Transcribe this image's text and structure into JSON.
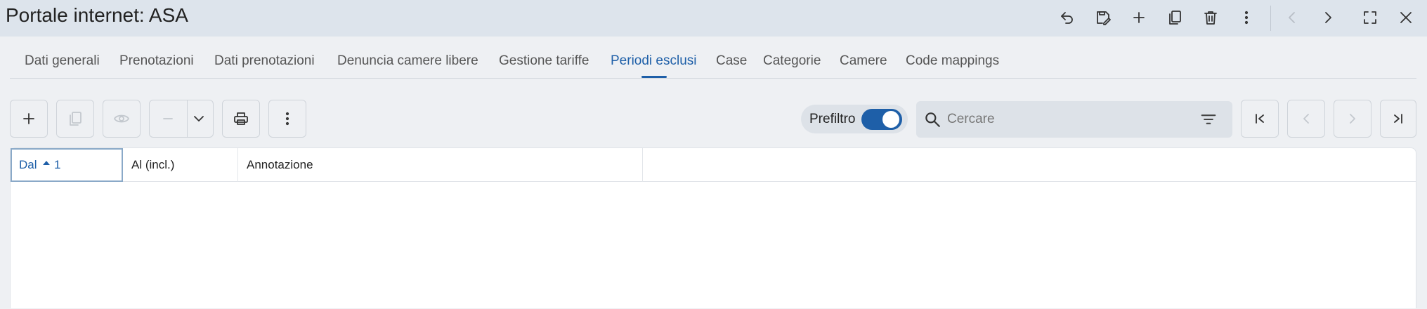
{
  "window": {
    "title": "Portale internet: ASA"
  },
  "titlebar_icons": [
    {
      "name": "undo-icon",
      "enabled": true
    },
    {
      "name": "save-edit-icon",
      "enabled": true
    },
    {
      "name": "add-icon",
      "enabled": true
    },
    {
      "name": "copy-icon",
      "enabled": true
    },
    {
      "name": "delete-icon",
      "enabled": true
    },
    {
      "name": "more-vertical-icon",
      "enabled": true
    },
    {
      "name": "chevron-left-icon",
      "enabled": false
    },
    {
      "name": "chevron-right-icon",
      "enabled": true
    },
    {
      "name": "fullscreen-icon",
      "enabled": true
    },
    {
      "name": "close-icon",
      "enabled": true
    }
  ],
  "tabs": [
    {
      "label": "Dati generali",
      "active": false
    },
    {
      "label": "Prenotazioni",
      "active": false
    },
    {
      "label": "Dati prenotazioni",
      "active": false
    },
    {
      "label": "Denuncia camere libere",
      "active": false
    },
    {
      "label": "Gestione tariffe",
      "active": false
    },
    {
      "label": "Periodi esclusi",
      "active": true
    },
    {
      "label": "Case",
      "active": false
    },
    {
      "label": "Categorie",
      "active": false
    },
    {
      "label": "Camere",
      "active": false
    },
    {
      "label": "Code mappings",
      "active": false
    }
  ],
  "toolbar": {
    "buttons": [
      {
        "name": "add-icon",
        "enabled": true
      },
      {
        "name": "copy-icon",
        "enabled": false
      },
      {
        "name": "eye-icon",
        "enabled": false
      },
      {
        "name": "minus-icon",
        "enabled": false
      },
      {
        "name": "chevron-down-icon",
        "enabled": true
      },
      {
        "name": "print-icon",
        "enabled": true
      },
      {
        "name": "more-vertical-icon",
        "enabled": true
      }
    ],
    "prefilter_label": "Prefiltro",
    "prefilter_on": true,
    "search_placeholder": "Cercare",
    "nav_buttons": [
      {
        "name": "first-page-icon",
        "enabled": true
      },
      {
        "name": "previous-page-icon",
        "enabled": false
      },
      {
        "name": "next-page-icon",
        "enabled": false
      },
      {
        "name": "last-page-icon",
        "enabled": true
      }
    ]
  },
  "grid": {
    "columns": [
      {
        "label": "Dal",
        "sorted": "asc",
        "sort_order": "1"
      },
      {
        "label": "Al (incl.)"
      },
      {
        "label": "Annotazione"
      }
    ],
    "rows": []
  },
  "colors": {
    "accent": "#1e5fa8",
    "titlebar_bg": "#dde4ec",
    "page_bg": "#eef0f3"
  }
}
